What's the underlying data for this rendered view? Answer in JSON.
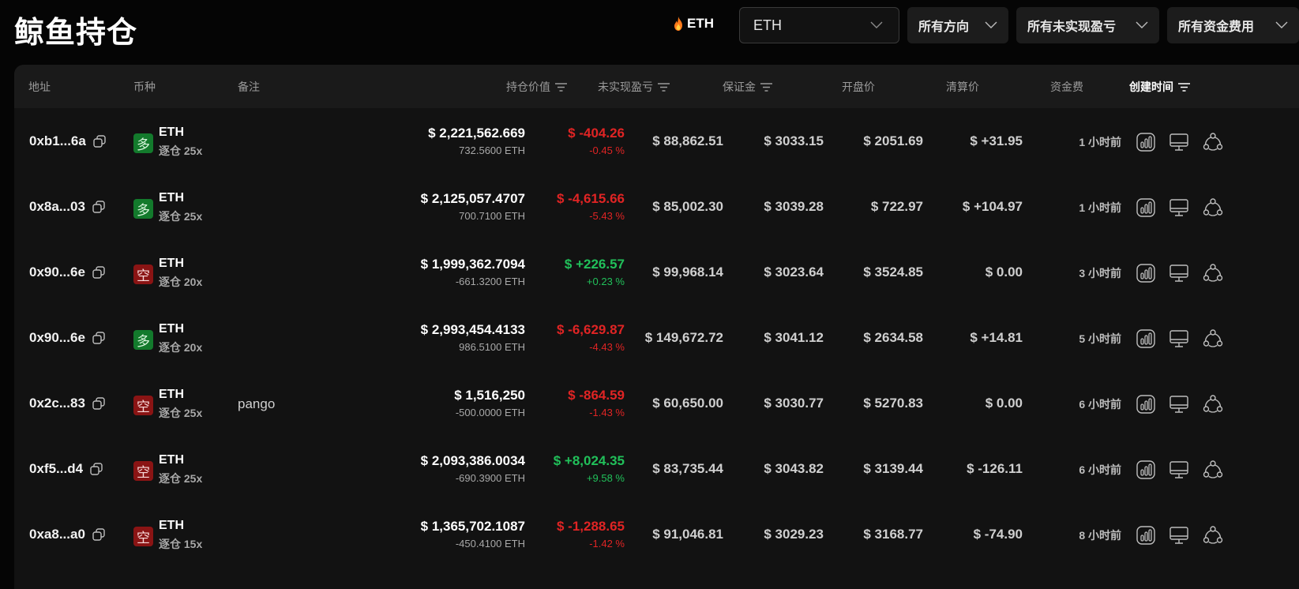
{
  "page": {
    "title": "鲸鱼持仓"
  },
  "header": {
    "coin_tag": "ETH",
    "coin_select": {
      "value": "ETH"
    },
    "direction_select": {
      "value": "所有方向"
    },
    "pnl_select": {
      "value": "所有未实现盈亏"
    },
    "funding_select": {
      "value": "所有资金费用"
    }
  },
  "table": {
    "columns": {
      "address": "地址",
      "coin": "币种",
      "note": "备注",
      "position_value": "持仓价值",
      "unrealized_pnl": "未实现盈亏",
      "margin": "保证金",
      "entry_price": "开盘价",
      "liq_price": "清算价",
      "funding": "资金费",
      "created": "创建时间"
    },
    "rows": [
      {
        "address": "0xb1...6a",
        "side": "多",
        "side_type": "long",
        "symbol": "ETH",
        "leverage": "逐仓 25x",
        "note": "",
        "value": "$ 2,221,562.669",
        "size": "732.5600 ETH",
        "pnl": "$ -404.26",
        "pnl_pct": "-0.45 %",
        "pnl_sign": "neg",
        "margin": "$ 88,862.51",
        "entry": "$ 3033.15",
        "liq": "$ 2051.69",
        "funding": "$ +31.95",
        "funding_sign": "pos",
        "created": "1 小时前"
      },
      {
        "address": "0x8a...03",
        "side": "多",
        "side_type": "long",
        "symbol": "ETH",
        "leverage": "逐仓 25x",
        "note": "",
        "value": "$ 2,125,057.4707",
        "size": "700.7100 ETH",
        "pnl": "$ -4,615.66",
        "pnl_pct": "-5.43 %",
        "pnl_sign": "neg",
        "margin": "$ 85,002.30",
        "entry": "$ 3039.28",
        "liq": "$ 722.97",
        "funding": "$ +104.97",
        "funding_sign": "pos",
        "created": "1 小时前"
      },
      {
        "address": "0x90...6e",
        "side": "空",
        "side_type": "short",
        "symbol": "ETH",
        "leverage": "逐仓 20x",
        "note": "",
        "value": "$ 1,999,362.7094",
        "size": "-661.3200 ETH",
        "pnl": "$ +226.57",
        "pnl_pct": "+0.23 %",
        "pnl_sign": "pos",
        "margin": "$ 99,968.14",
        "entry": "$ 3023.64",
        "liq": "$ 3524.85",
        "funding": "$ 0.00",
        "funding_sign": "neutral",
        "created": "3 小时前"
      },
      {
        "address": "0x90...6e",
        "side": "多",
        "side_type": "long",
        "symbol": "ETH",
        "leverage": "逐仓 20x",
        "note": "",
        "value": "$ 2,993,454.4133",
        "size": "986.5100 ETH",
        "pnl": "$ -6,629.87",
        "pnl_pct": "-4.43 %",
        "pnl_sign": "neg",
        "margin": "$ 149,672.72",
        "entry": "$ 3041.12",
        "liq": "$ 2634.58",
        "funding": "$ +14.81",
        "funding_sign": "pos",
        "created": "5 小时前"
      },
      {
        "address": "0x2c...83",
        "side": "空",
        "side_type": "short",
        "symbol": "ETH",
        "leverage": "逐仓 25x",
        "note": "pango",
        "value": "$ 1,516,250",
        "size": "-500.0000 ETH",
        "pnl": "$ -864.59",
        "pnl_pct": "-1.43 %",
        "pnl_sign": "neg",
        "margin": "$ 60,650.00",
        "entry": "$ 3030.77",
        "liq": "$ 5270.83",
        "funding": "$ 0.00",
        "funding_sign": "neutral",
        "created": "6 小时前"
      },
      {
        "address": "0xf5...d4",
        "side": "空",
        "side_type": "short",
        "symbol": "ETH",
        "leverage": "逐仓 25x",
        "note": "",
        "value": "$ 2,093,386.0034",
        "size": "-690.3900 ETH",
        "pnl": "$ +8,024.35",
        "pnl_pct": "+9.58 %",
        "pnl_sign": "pos",
        "margin": "$ 83,735.44",
        "entry": "$ 3043.82",
        "liq": "$ 3139.44",
        "funding": "$ -126.11",
        "funding_sign": "neg",
        "created": "6 小时前"
      },
      {
        "address": "0xa8...a0",
        "side": "空",
        "side_type": "short",
        "symbol": "ETH",
        "leverage": "逐仓 15x",
        "note": "",
        "value": "$ 1,365,702.1087",
        "size": "-450.4100 ETH",
        "pnl": "$ -1,288.65",
        "pnl_pct": "-1.42 %",
        "pnl_sign": "neg",
        "margin": "$ 91,046.81",
        "entry": "$ 3029.23",
        "liq": "$ 3168.77",
        "funding": "$ -74.90",
        "funding_sign": "neg",
        "created": "8 小时前"
      }
    ]
  },
  "icons": {
    "flame": "flame-icon",
    "chevron": "chevron-down-icon",
    "sort": "sort-filter-icon",
    "copy": "copy-icon",
    "actions": [
      "chart-icon",
      "monitor-icon",
      "share-icon"
    ]
  },
  "colors": {
    "background": "#050505",
    "panel": "#121212",
    "positive": "#21c05a",
    "negative": "#e02424",
    "long_badge": "#137a2c",
    "short_badge": "#8a1414"
  }
}
